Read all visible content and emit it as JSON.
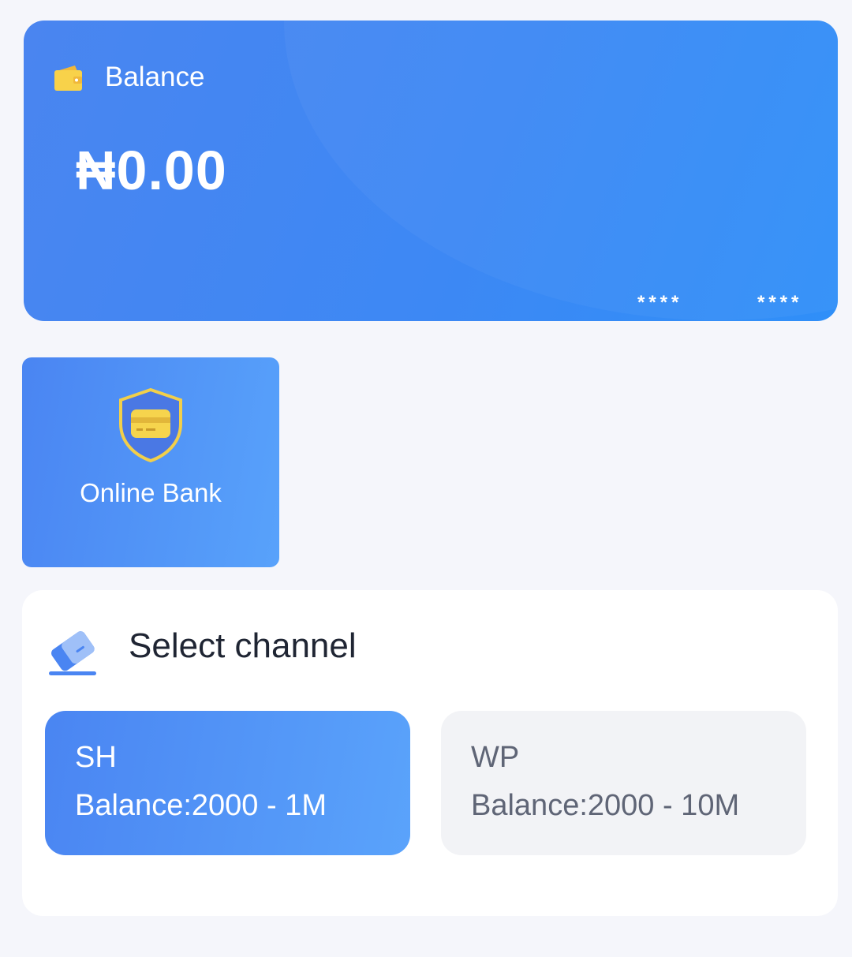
{
  "balance": {
    "label": "Balance",
    "amount": "₦0.00",
    "masked_1": "****",
    "masked_2": "****"
  },
  "online_bank": {
    "label": "Online Bank"
  },
  "channel": {
    "title": "Select channel",
    "options": [
      {
        "name": "SH",
        "range": "Balance:2000 - 1M",
        "selected": true
      },
      {
        "name": "WP",
        "range": "Balance:2000 - 10M",
        "selected": false
      }
    ]
  },
  "colors": {
    "primary_blue": "#4a85f2",
    "accent_yellow": "#f5cf3d",
    "background": "#f5f6fb"
  },
  "icons": [
    "wallet-icon",
    "shield-card-icon",
    "card-icon"
  ]
}
